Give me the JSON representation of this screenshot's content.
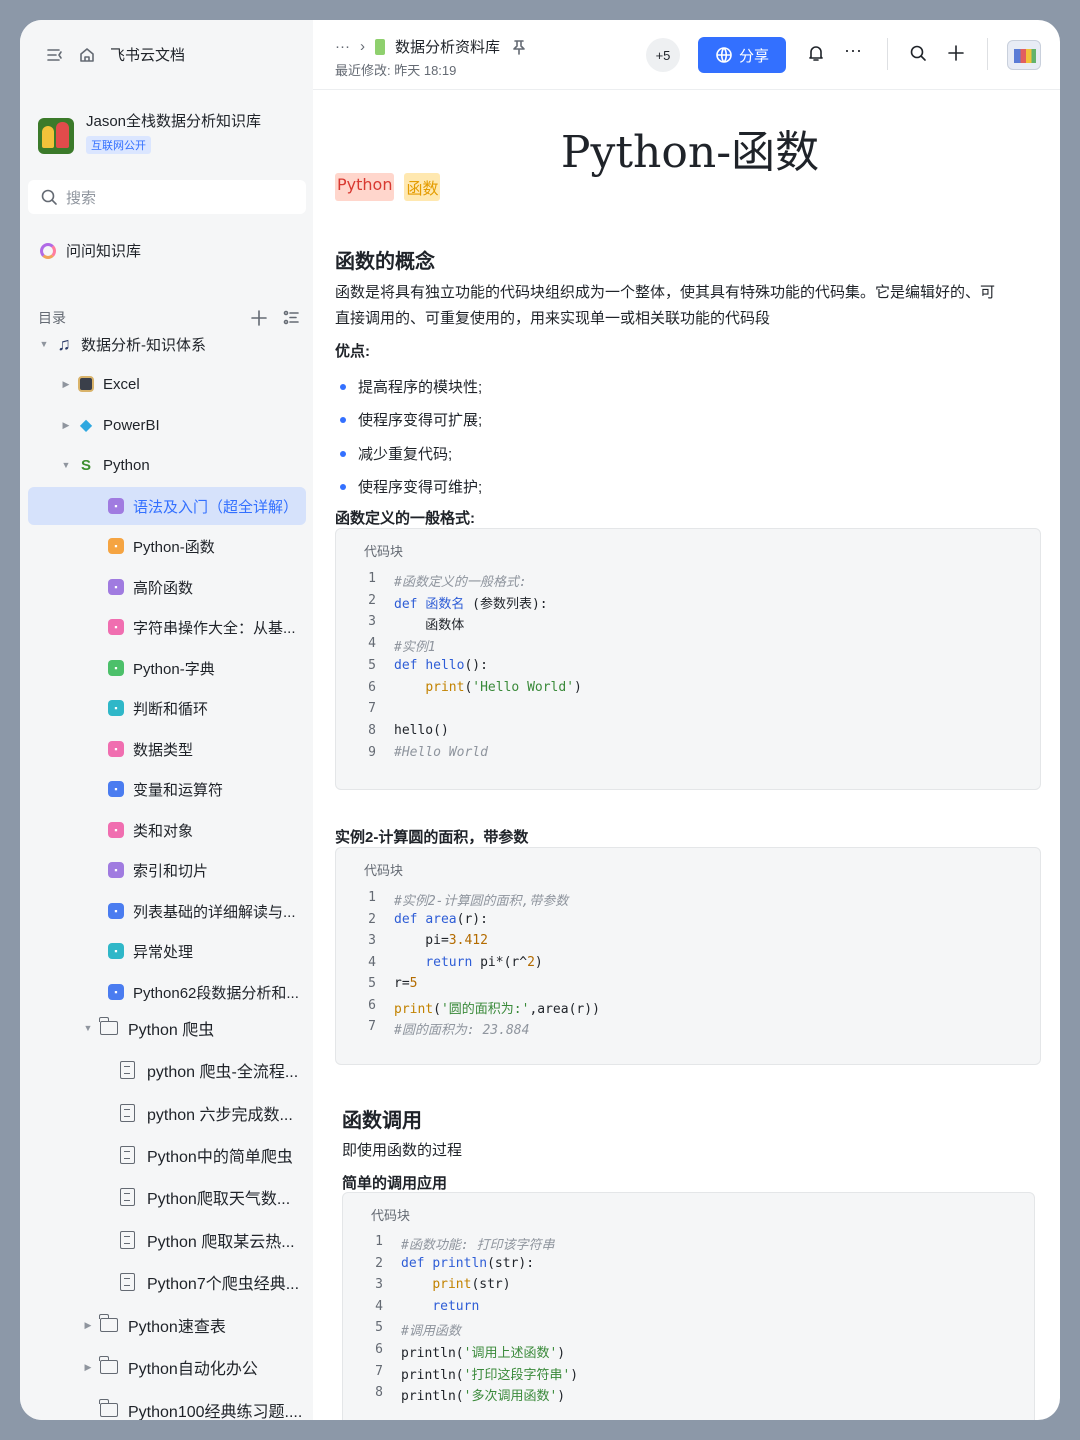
{
  "sidebar": {
    "app_name": "飞书云文档",
    "kb_title": "Jason全栈数据分析知识库",
    "kb_badge": "互联网公开",
    "search_placeholder": "搜索",
    "ask_label": "问问知识库",
    "toc_label": "目录",
    "items": [
      {
        "label": "数据分析-知识体系",
        "indent": 0,
        "arrow": "down",
        "icon": "music-note-icon"
      },
      {
        "label": "Excel",
        "indent": 1,
        "arrow": "right",
        "icon": "spreadsheet-icon"
      },
      {
        "label": "PowerBI",
        "indent": 1,
        "arrow": "right",
        "icon": "gem-icon"
      },
      {
        "label": "Python",
        "indent": 1,
        "arrow": "down",
        "icon": "snake-icon"
      },
      {
        "label": "语法及入门（超全详解）",
        "indent": 2,
        "selected": true,
        "color": "#a07be0"
      },
      {
        "label": "Python-函数",
        "indent": 2,
        "color": "#f5a442"
      },
      {
        "label": "高阶函数",
        "indent": 2,
        "color": "#a07be0"
      },
      {
        "label": "字符串操作大全：从基...",
        "indent": 2,
        "color": "#f06eb0"
      },
      {
        "label": "Python-字典",
        "indent": 2,
        "color": "#4cc06a"
      },
      {
        "label": "判断和循环",
        "indent": 2,
        "color": "#2fb7c8"
      },
      {
        "label": "数据类型",
        "indent": 2,
        "color": "#f06eb0"
      },
      {
        "label": "变量和运算符",
        "indent": 2,
        "color": "#4a7cf0"
      },
      {
        "label": "类和对象",
        "indent": 2,
        "color": "#f06eb0"
      },
      {
        "label": "索引和切片",
        "indent": 2,
        "color": "#a07be0"
      },
      {
        "label": "列表基础的详细解读与...",
        "indent": 2,
        "color": "#4a7cf0"
      },
      {
        "label": "异常处理",
        "indent": 2,
        "color": "#2fb7c8"
      },
      {
        "label": "Python62段数据分析和...",
        "indent": 2,
        "color": "#4a7cf0"
      },
      {
        "label": "Python 爬虫",
        "indent": 2,
        "arrow": "down",
        "icon": "folder-icon"
      },
      {
        "label": "python 爬虫-全流程...",
        "indent": 3,
        "icon": "doc-icon"
      },
      {
        "label": "python 六步完成数...",
        "indent": 3,
        "icon": "doc-icon"
      },
      {
        "label": "Python中的简单爬虫",
        "indent": 3,
        "icon": "doc-icon"
      },
      {
        "label": "Python爬取天气数...",
        "indent": 3,
        "icon": "doc-icon"
      },
      {
        "label": "Python 爬取某云热...",
        "indent": 3,
        "icon": "doc-icon"
      },
      {
        "label": "Python7个爬虫经典...",
        "indent": 3,
        "icon": "doc-icon"
      },
      {
        "label": "Python速查表",
        "indent": 2,
        "arrow": "right",
        "icon": "folder-icon"
      },
      {
        "label": "Python自动化办公",
        "indent": 2,
        "arrow": "right",
        "icon": "folder-icon"
      },
      {
        "label": "Python100经典练习题....",
        "indent": 2,
        "icon": "folder-icon"
      }
    ]
  },
  "header": {
    "more": "···",
    "breadcrumb": "数据分析资料库",
    "last_modified": "最近修改: 昨天 18:19",
    "collaborators": "+5",
    "share_label": "分享"
  },
  "doc": {
    "title": "Python-函数",
    "tags": [
      "Python",
      "函数"
    ],
    "section1_heading": "函数的概念",
    "section1_p1": "函数是将具有独立功能的代码块组织成为一个整体，使其具有特殊功能的代码集。它是编辑好的、可",
    "section1_p2": "直接调用的、可重复使用的，用来实现单一或相关联功能的代码段",
    "adv_label": "优点:",
    "bullets": [
      "提高程序的模块性;",
      "使程序变得可扩展;",
      "减少重复代码;",
      "使程序变得可维护;"
    ],
    "format_label": "函数定义的一般格式:",
    "code_label": "代码块",
    "example2_label": "实例2-计算圆的面积，带参数",
    "section2_heading": "函数调用",
    "section2_p": "即使用函数的过程",
    "simple_call_label": "简单的调用应用"
  },
  "code1": [
    {
      "n": "1",
      "parts": [
        [
          "cm",
          "#函数定义的一般格式:"
        ]
      ]
    },
    {
      "n": "2",
      "parts": [
        [
          "kw",
          "def "
        ],
        [
          "fn",
          "函数名"
        ],
        [
          "",
          " (参数列表):"
        ]
      ]
    },
    {
      "n": "3",
      "parts": [
        [
          "",
          "    函数体"
        ]
      ]
    },
    {
      "n": "4",
      "parts": [
        [
          "cm",
          "#实例1"
        ]
      ]
    },
    {
      "n": "5",
      "parts": [
        [
          "kw",
          "def "
        ],
        [
          "fn",
          "hello"
        ],
        [
          "",
          "():"
        ]
      ]
    },
    {
      "n": "6",
      "parts": [
        [
          "",
          "    "
        ],
        [
          "bi",
          "print"
        ],
        [
          "",
          "("
        ],
        [
          "st",
          "'Hello World'"
        ],
        [
          "",
          ")"
        ]
      ]
    },
    {
      "n": "7",
      "parts": [
        [
          "",
          ""
        ]
      ]
    },
    {
      "n": "8",
      "parts": [
        [
          "",
          "hello()"
        ]
      ]
    },
    {
      "n": "9",
      "parts": [
        [
          "cm",
          "#Hello World"
        ]
      ]
    }
  ],
  "code2": [
    {
      "n": "1",
      "parts": [
        [
          "cm",
          "#实例2-计算圆的面积,带参数"
        ]
      ]
    },
    {
      "n": "2",
      "parts": [
        [
          "kw",
          "def "
        ],
        [
          "fn",
          "area"
        ],
        [
          "",
          "(r):"
        ]
      ]
    },
    {
      "n": "3",
      "parts": [
        [
          "",
          "    pi="
        ],
        [
          "nm",
          "3.412"
        ]
      ]
    },
    {
      "n": "4",
      "parts": [
        [
          "",
          "    "
        ],
        [
          "kw",
          "return"
        ],
        [
          "",
          " pi*(r^"
        ],
        [
          "nm",
          "2"
        ],
        [
          "",
          ")"
        ]
      ]
    },
    {
      "n": "5",
      "parts": [
        [
          "",
          "r="
        ],
        [
          "nm",
          "5"
        ]
      ]
    },
    {
      "n": "6",
      "parts": [
        [
          "bi",
          "print"
        ],
        [
          "",
          "("
        ],
        [
          "st",
          "'圆的面积为:'"
        ],
        [
          "",
          ",area(r))"
        ]
      ]
    },
    {
      "n": "7",
      "parts": [
        [
          "cm",
          "#圆的面积为: 23.884"
        ]
      ]
    }
  ],
  "code3": [
    {
      "n": "1",
      "parts": [
        [
          "cm",
          "#函数功能: 打印该字符串"
        ]
      ]
    },
    {
      "n": "2",
      "parts": [
        [
          "kw",
          "def "
        ],
        [
          "fn",
          "println"
        ],
        [
          "",
          "(str):"
        ]
      ]
    },
    {
      "n": "3",
      "parts": [
        [
          "",
          "    "
        ],
        [
          "bi",
          "print"
        ],
        [
          "",
          "(str)"
        ]
      ]
    },
    {
      "n": "4",
      "parts": [
        [
          "",
          "    "
        ],
        [
          "kw",
          "return"
        ]
      ]
    },
    {
      "n": "5",
      "parts": [
        [
          "cm",
          "#调用函数"
        ]
      ]
    },
    {
      "n": "6",
      "parts": [
        [
          "",
          "println("
        ],
        [
          "st",
          "'调用上述函数'"
        ],
        [
          "",
          ")"
        ]
      ]
    },
    {
      "n": "7",
      "parts": [
        [
          "",
          "println("
        ],
        [
          "st",
          "'打印这段字符串'"
        ],
        [
          "",
          ")"
        ]
      ]
    },
    {
      "n": "8",
      "parts": [
        [
          "",
          "println("
        ],
        [
          "st",
          "'多次调用函数'"
        ],
        [
          "",
          ")"
        ]
      ]
    }
  ]
}
